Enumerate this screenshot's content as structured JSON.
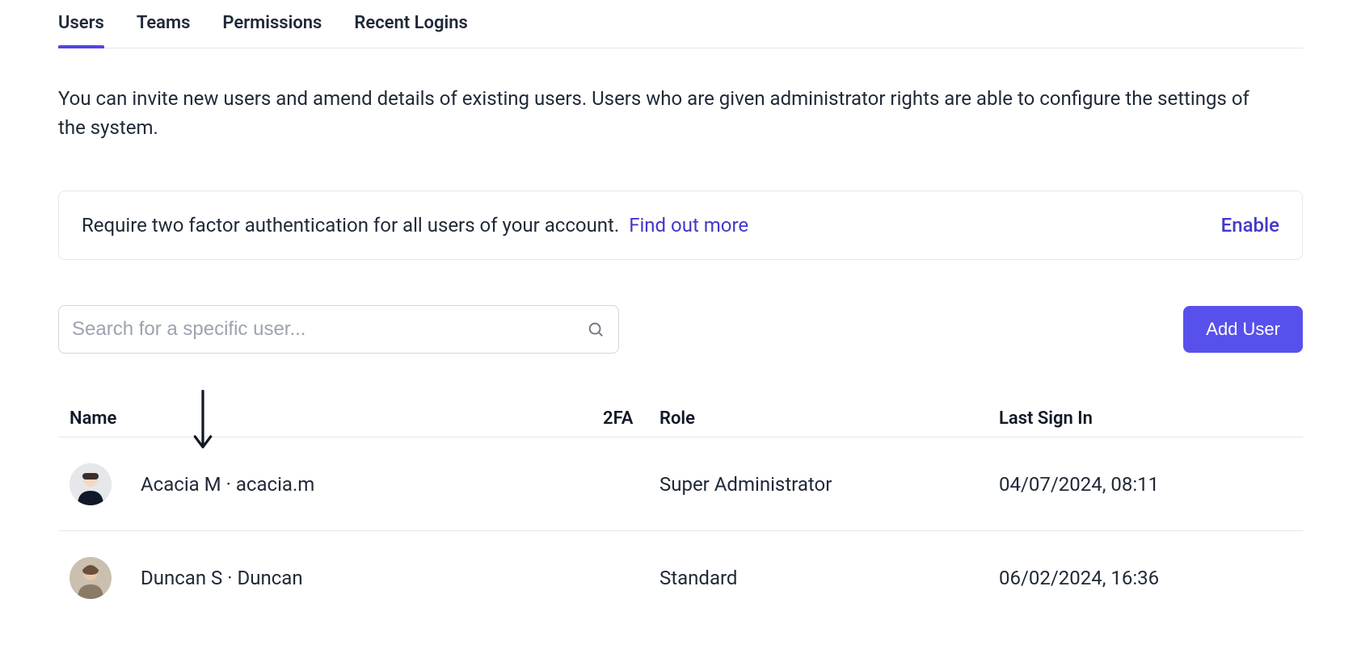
{
  "tabs": [
    {
      "label": "Users",
      "active": true
    },
    {
      "label": "Teams",
      "active": false
    },
    {
      "label": "Permissions",
      "active": false
    },
    {
      "label": "Recent Logins",
      "active": false
    }
  ],
  "description": "You can invite new users and amend details of existing users. Users who are given administrator rights are able to configure the settings of the system.",
  "banner": {
    "text": "Require two factor authentication for all users of your account.",
    "link": "Find out more",
    "action": "Enable"
  },
  "search": {
    "placeholder": "Search for a specific user..."
  },
  "add_button": "Add User",
  "columns": {
    "name": "Name",
    "twofa": "2FA",
    "role": "Role",
    "last_sign_in": "Last Sign In"
  },
  "rows": [
    {
      "display_name": "Acacia M",
      "username": "acacia.m",
      "twofa": "",
      "role": "Super Administrator",
      "last_sign_in": "04/07/2024, 08:11"
    },
    {
      "display_name": "Duncan S",
      "username": "Duncan",
      "twofa": "",
      "role": "Standard",
      "last_sign_in": "06/02/2024, 16:36"
    }
  ]
}
